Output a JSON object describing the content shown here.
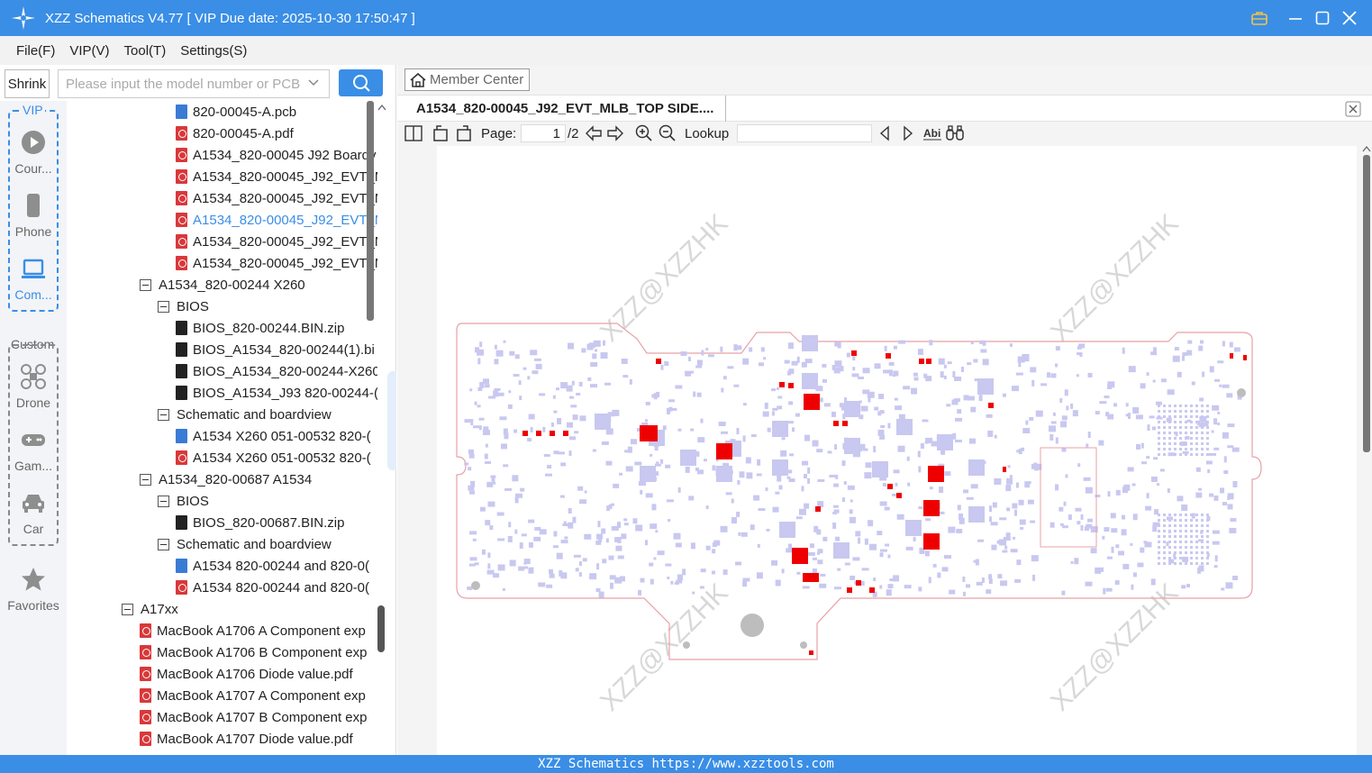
{
  "window": {
    "title": "XZZ Schematics V4.77 [ VIP Due date: 2025-10-30 17:50:47 ]"
  },
  "menu": [
    "File(F)",
    "VIP(V)",
    "Tool(T)",
    "Settings(S)"
  ],
  "search": {
    "shrink_label": "Shrink",
    "placeholder": "Please input the model number or PCB"
  },
  "sidebar": {
    "vip_label": "VIP",
    "custom_label": "Custom",
    "items": [
      {
        "label": "Cour...",
        "icon": "play-circle-icon"
      },
      {
        "label": "Phone",
        "icon": "phone-icon"
      },
      {
        "label": "Com...",
        "icon": "laptop-icon"
      },
      {
        "label": "Drone",
        "icon": "drone-icon"
      },
      {
        "label": "Gam...",
        "icon": "gamepad-icon"
      },
      {
        "label": "Car",
        "icon": "car-icon"
      },
      {
        "label": "Favorites",
        "icon": "star-icon"
      }
    ]
  },
  "tree": [
    {
      "label": "820-00045-A.pcb",
      "type": "pcb",
      "level": 3
    },
    {
      "label": "820-00045-A.pdf",
      "type": "pdf",
      "level": 3
    },
    {
      "label": "A1534_820-00045 J92 Boardv",
      "type": "pdf",
      "level": 3
    },
    {
      "label": "A1534_820-00045_J92_EVT_M",
      "type": "pdf",
      "level": 3
    },
    {
      "label": "A1534_820-00045_J92_EVT_M",
      "type": "pdf",
      "level": 3
    },
    {
      "label": "A1534_820-00045_J92_EVT_M",
      "type": "pdf",
      "level": 3,
      "selected": true
    },
    {
      "label": "A1534_820-00045_J92_EVT_M",
      "type": "pdf",
      "level": 3
    },
    {
      "label": "A1534_820-00045_J92_EVT_M",
      "type": "pdf",
      "level": 3
    },
    {
      "label": "A1534_820-00244 X260",
      "type": "folder",
      "level": 1
    },
    {
      "label": "BIOS",
      "type": "folder",
      "level": 2
    },
    {
      "label": "BIOS_820-00244.BIN.zip",
      "type": "zip",
      "level": 3
    },
    {
      "label": "BIOS_A1534_820-00244(1).bi",
      "type": "zip",
      "level": 3
    },
    {
      "label": "BIOS_A1534_820-00244-X260",
      "type": "zip",
      "level": 3
    },
    {
      "label": "BIOS_A1534_J93 820-00244-(",
      "type": "zip",
      "level": 3
    },
    {
      "label": "Schematic and boardview",
      "type": "folder",
      "level": 2
    },
    {
      "label": "A1534 X260 051-00532 820-(",
      "type": "pcb",
      "level": 3
    },
    {
      "label": "A1534 X260 051-00532 820-(",
      "type": "pdf",
      "level": 3
    },
    {
      "label": "A1534_820-00687 A1534",
      "type": "folder",
      "level": 1
    },
    {
      "label": "BIOS",
      "type": "folder",
      "level": 2
    },
    {
      "label": "BIOS_820-00687.BIN.zip",
      "type": "zip",
      "level": 3
    },
    {
      "label": "Schematic and boardview",
      "type": "folder",
      "level": 2
    },
    {
      "label": "A1534 820-00244 and 820-0(",
      "type": "pcb",
      "level": 3
    },
    {
      "label": "A1534 820-00244 and 820-0(",
      "type": "pdf",
      "level": 3
    },
    {
      "label": "A17xx",
      "type": "folder",
      "level": 0
    },
    {
      "label": "MacBook A1706 A Component exp",
      "type": "pdf",
      "level": 1
    },
    {
      "label": "MacBook A1706 B Component exp",
      "type": "pdf",
      "level": 1
    },
    {
      "label": "MacBook A1706 Diode value.pdf",
      "type": "pdf",
      "level": 1
    },
    {
      "label": "MacBook A1707 A Component exp",
      "type": "pdf",
      "level": 1
    },
    {
      "label": "MacBook A1707 B Component exp",
      "type": "pdf",
      "level": 1
    },
    {
      "label": "MacBook A1707 Diode value.pdf",
      "type": "pdf",
      "level": 1
    }
  ],
  "viewer": {
    "member_center": "Member Center",
    "tab_title": "A1534_820-00045_J92_EVT_MLB_TOP SIDE....",
    "page_label": "Page:",
    "page_current": "1",
    "page_total": "/2",
    "lookup_label": "Lookup",
    "lookup_value": "",
    "watermark": "XZZ@XZZHK"
  },
  "status": {
    "text": "XZZ Schematics https://www.xzztools.com"
  },
  "colors": {
    "accent": "#3a8ee6",
    "component": "#c8c8f0",
    "highlight": "#ee0000",
    "outline": "#e8a0a8"
  }
}
